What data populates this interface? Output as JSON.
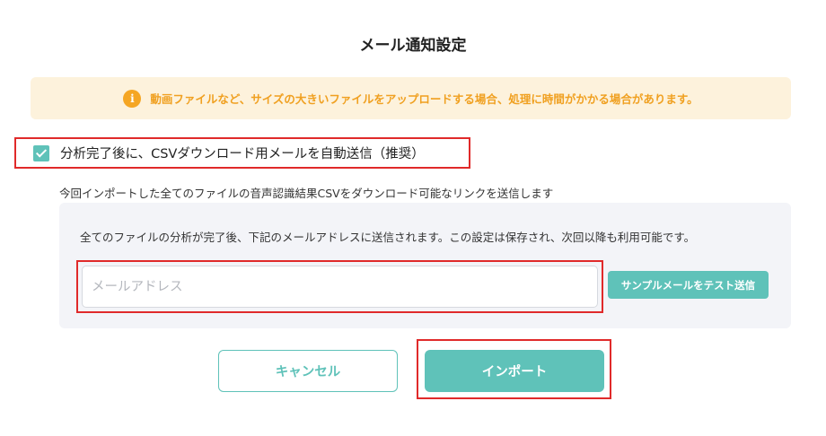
{
  "dialog": {
    "title": "メール通知設定"
  },
  "notice": {
    "icon": "info-icon",
    "icon_glyph": "i",
    "text": "動画ファイルなど、サイズの大きいファイルをアップロードする場合、処理に時間がかかる場合があります。",
    "color": "#f0a020",
    "background": "#fdf2dc"
  },
  "auto_send": {
    "checked": true,
    "label": "分析完了後に、CSVダウンロード用メールを自動送信（推奨）"
  },
  "description": "今回インポートした全てのファイルの音声認識結果CSVをダウンロード可能なリンクを送信します",
  "email_panel": {
    "info_text": "全てのファイルの分析が完了後、下記のメールアドレスに送信されます。この設定は保存され、次回以降も利用可能です。",
    "email_value": "",
    "email_placeholder": "メールアドレス",
    "test_send_label": "サンプルメールをテスト送信"
  },
  "actions": {
    "cancel_label": "キャンセル",
    "import_label": "インポート"
  },
  "colors": {
    "accent": "#5fc2b9",
    "highlight_border": "#e02a2a"
  }
}
